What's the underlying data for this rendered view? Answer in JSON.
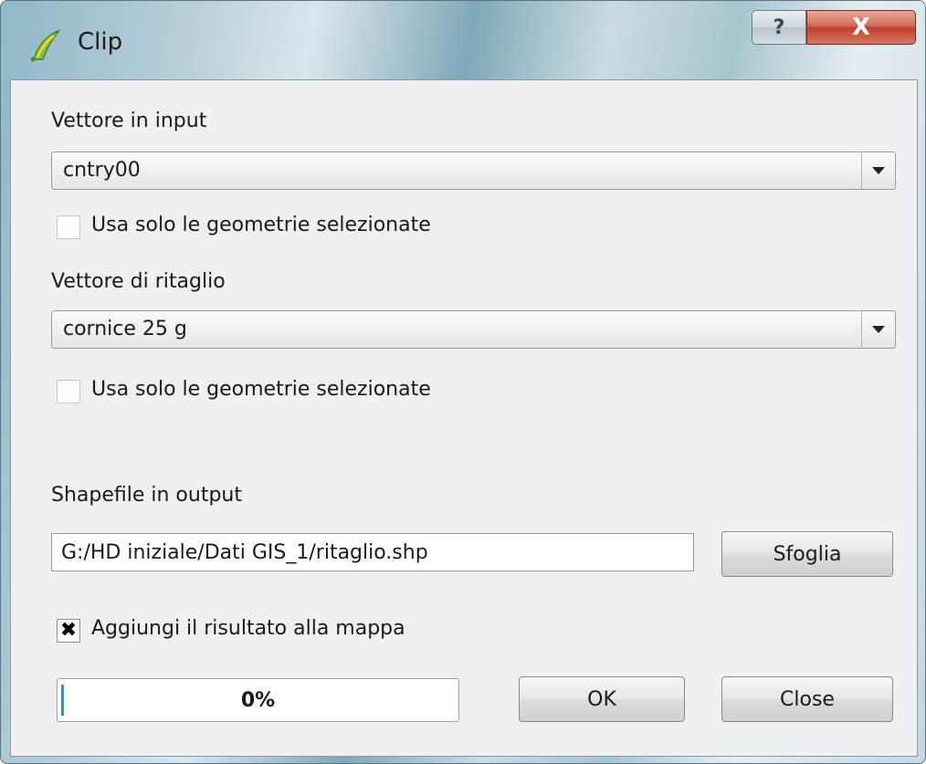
{
  "window": {
    "title": "Clip",
    "help_label": "?",
    "close_label": "X"
  },
  "input_vector": {
    "label": "Vettore in input",
    "selected": "cntry00",
    "use_selected_label": "Usa solo le geometrie selezionate",
    "use_selected_checked": false
  },
  "clip_vector": {
    "label": "Vettore di ritaglio",
    "selected": "cornice 25 g",
    "use_selected_label": "Usa solo le geometrie selezionate",
    "use_selected_checked": false
  },
  "output": {
    "label": "Shapefile in output",
    "path": "G:/HD iniziale/Dati GIS_1/ritaglio.shp",
    "browse_label": "Sfoglia"
  },
  "add_to_map": {
    "label": "Aggiungi il risultato alla mappa",
    "checked": true,
    "check_mark": "✖"
  },
  "progress": {
    "text": "0%",
    "value_percent": 0
  },
  "buttons": {
    "ok_label": "OK",
    "close_label": "Close"
  },
  "colors": {
    "progress_accent": "#2e8de0",
    "close_button": "#c0402a"
  },
  "icons": {
    "app": "qgis-clip-icon",
    "dropdown": "chevron-down-icon"
  }
}
